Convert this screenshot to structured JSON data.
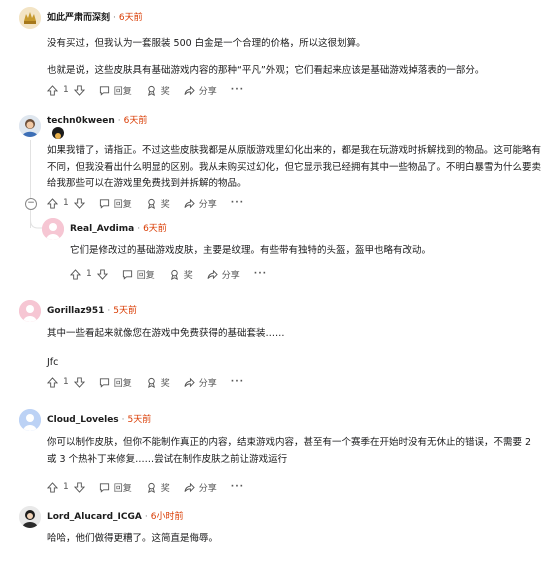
{
  "comments": [
    {
      "author": "如此严肃而深刻",
      "age": "6天前",
      "body": [
        "没有买过，但我认为一套服装 500 白金是一个合理的价格，所以这很划算。",
        "也就是说，这些皮肤具有基础游戏内容的那种“平凡”外观；它们看起来应该是基础游戏掉落表的一部分。"
      ],
      "votes": "1",
      "reply": "回复",
      "award": "奖",
      "share": "分享"
    },
    {
      "author": "techn0kween",
      "age": "6天前",
      "body": [
        "如果我错了，请指正。不过这些皮肤我都是从原版游戏里幻化出来的，都是我在玩游戏时拆解找到的物品。这可能略有不同，但我没看出什么明显的区别。我从未购买过幻化，但它显示我已经拥有其中一些物品了。不明白暴雪为什么要卖给我那些可以在游戏里免费找到并拆解的物品。"
      ],
      "votes": "1",
      "reply": "回复",
      "award": "奖",
      "share": "分享"
    },
    {
      "author": "Real_Avdima",
      "age": "6天前",
      "body": [
        "它们是修改过的基础游戏皮肤，主要是纹理。有些带有独特的头盔，盔甲也略有改动。"
      ],
      "votes": "1",
      "reply": "回复",
      "award": "奖",
      "share": "分享"
    },
    {
      "author": "Gorillaz951",
      "age": "5天前",
      "body": [
        "其中一些看起来就像您在游戏中免费获得的基础套装……",
        "Jfc"
      ],
      "votes": "1",
      "reply": "回复",
      "award": "奖",
      "share": "分享"
    },
    {
      "author": "Cloud_Loveles",
      "age": "5天前",
      "body": [
        "你可以制作皮肤，但你不能制作真正的内容，结束游戏内容，甚至有一个赛季在开始时没有无休止的错误，不需要 2 或 3 个热补丁来修复……尝试在制作皮肤之前让游戏运行"
      ],
      "votes": "1",
      "reply": "回复",
      "award": "奖",
      "share": "分享"
    },
    {
      "author": "Lord_Alucard_ICGA",
      "age": "6小时前",
      "body": [
        "哈哈，他们做得更糟了。这简直是侮辱。"
      ],
      "votes": "",
      "reply": "",
      "award": "",
      "share": ""
    }
  ],
  "more_label": "···",
  "collapse_label": "−",
  "colors": {
    "age": "#d93a00",
    "author": "#1c1c1c",
    "thread_line": "#e2e2e2"
  }
}
